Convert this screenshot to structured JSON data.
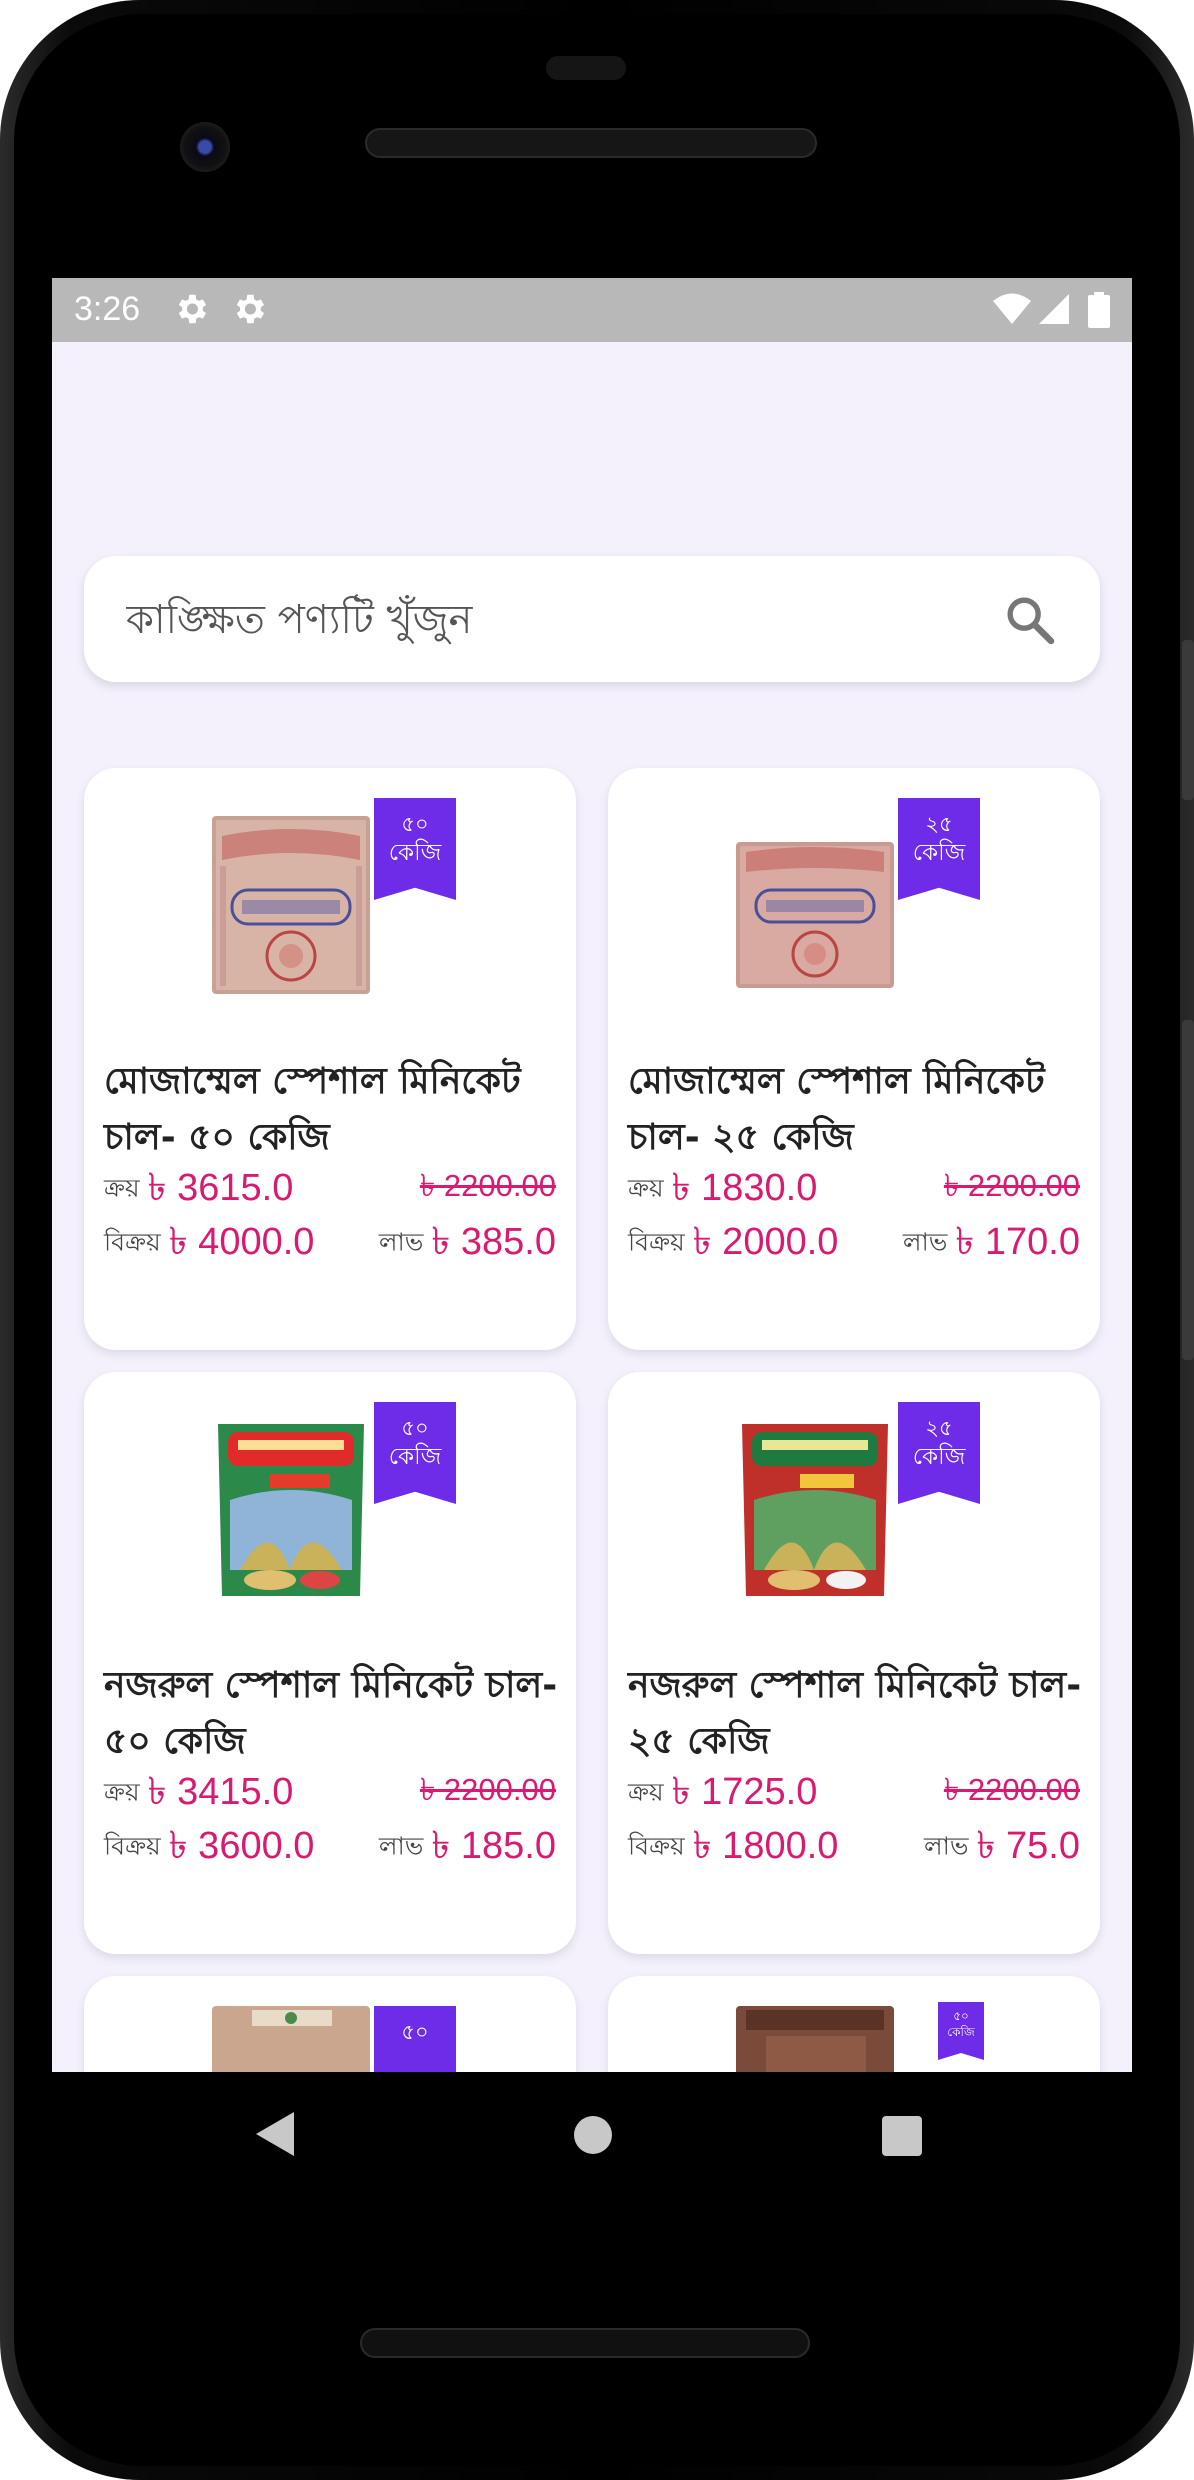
{
  "status_bar": {
    "time": "3:26",
    "icons": [
      "gear-icon",
      "gear-icon",
      "wifi-icon",
      "cell-signal-icon",
      "battery-icon"
    ]
  },
  "search": {
    "placeholder": "কাঙ্ক্ষিত পণ্যটি খুঁজুন",
    "icon": "search-icon"
  },
  "labels": {
    "buy": "ক্রয়",
    "sell": "বিক্রয়",
    "profit": "লাভ"
  },
  "products": [
    {
      "name": "মোজাম্মেল স্পেশাল মিনিকেট চাল- ৫০ কেজি",
      "badge_num": "৫০",
      "badge_unit": "কেজি",
      "buy_price": "৳ 3615.0",
      "old_price": "৳ 2200.00",
      "sell_price": "৳ 4000.0",
      "profit": "৳ 385.0",
      "thumbnail": "rice-sack-mozammel-50"
    },
    {
      "name": "মোজাম্মেল স্পেশাল মিনিকেট চাল- ২৫ কেজি",
      "badge_num": "২৫",
      "badge_unit": "কেজি",
      "buy_price": "৳ 1830.0",
      "old_price": "৳ 2200.00",
      "sell_price": "৳ 2000.0",
      "profit": "৳ 170.0",
      "thumbnail": "rice-sack-mozammel-25"
    },
    {
      "name": "নজরুল স্পেশাল মিনিকেট চাল- ৫০ কেজি",
      "badge_num": "৫০",
      "badge_unit": "কেজি",
      "buy_price": "৳ 3415.0",
      "old_price": "৳ 2200.00",
      "sell_price": "৳ 3600.0",
      "profit": "৳ 185.0",
      "thumbnail": "rice-bag-nazrul-50"
    },
    {
      "name": "নজরুল স্পেশাল মিনিকেট চাল- ২৫ কেজি",
      "badge_num": "২৫",
      "badge_unit": "কেজি",
      "buy_price": "৳ 1725.0",
      "old_price": "৳ 2200.00",
      "sell_price": "৳ 1800.0",
      "profit": "৳ 75.0",
      "thumbnail": "rice-bag-nazrul-25"
    },
    {
      "badge_num": "৫০",
      "thumbnail": "rice-sack-partial"
    },
    {
      "badge_num": "৫০",
      "badge_unit": "কেজি",
      "thumbnail": "rice-sack-brown-partial"
    }
  ],
  "nav": {
    "icons": [
      "back-icon",
      "home-icon",
      "recents-icon"
    ]
  },
  "colors": {
    "accent": "#6e2be8",
    "price": "#d81b70",
    "background": "#f4f1fd",
    "statusbar": "#b8b8b8"
  }
}
